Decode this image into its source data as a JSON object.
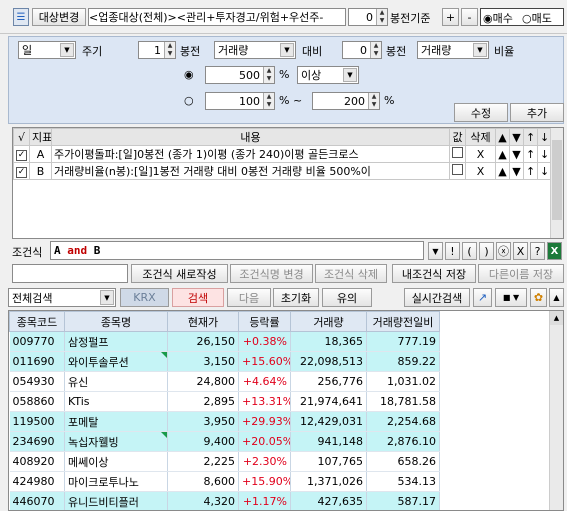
{
  "toolbar": {
    "change_target": "대상변경",
    "target_text": "<업종대상(전체)><관리+투자경고/위험+우선주-",
    "bongjeon_value": "0",
    "bongjeon_label": "봉전기준",
    "plus": "+",
    "minus": "-",
    "buy_label": "매수",
    "sell_label": "매도"
  },
  "form": {
    "period_value": "일",
    "period_label": "주기",
    "n1_value": "1",
    "bong1_label": "봉전",
    "field1_value": "거래량",
    "compare_label": "대비",
    "n2_value": "0",
    "bong2_label": "봉전",
    "field2_value": "거래량",
    "ratio_label": "비율",
    "val1": "500",
    "pct1": "%",
    "op_value": "이상",
    "val2": "100",
    "pct2": "% ~",
    "val3": "200",
    "pct3": "%",
    "modify_label": "수정",
    "add_label": "추가"
  },
  "conditions": {
    "headers": [
      "√",
      "지표",
      "내용",
      "값",
      "삭제",
      "▲",
      "▼",
      "↑",
      "↓"
    ],
    "rows": [
      {
        "id": "A",
        "content": "주가이평돌파:[일]0봉전 (종가 1)이평 (종가 240)이평 골든크로스",
        "del": "X",
        "up": "▲",
        "down": "▼",
        "top": "↑",
        "bottom": "↓"
      },
      {
        "id": "B",
        "content": "거래량비율(n봉):[일]1봉전 거래량 대비 0봉전 거래량 비율 500%이",
        "del": "X",
        "up": "▲",
        "down": "▼",
        "top": "↑",
        "bottom": "↓"
      }
    ]
  },
  "formula": {
    "label": "조건식",
    "a": "A",
    "and": "and",
    "b": "B",
    "btns": [
      "▼",
      "!",
      "(",
      ")",
      "ⓧ",
      "X",
      "?"
    ]
  },
  "actions": {
    "new": "조건식 새로작성",
    "rename": "조건식명 변경",
    "delete": "조건식 삭제",
    "save": "내조건식 저장",
    "save_as": "다른이름 저장"
  },
  "search": {
    "scope": "전체검색",
    "krx": "KRX",
    "search": "검색",
    "next": "다음",
    "reset": "초기화",
    "caution": "유의",
    "realtime": "실시간검색"
  },
  "colors": {
    "up": "#e0001b",
    "cyan": "#c5f4f6",
    "accent": "#1f5fbf"
  },
  "stocks": {
    "headers": [
      "종목코드",
      "종목명",
      "현재가",
      "등락률",
      "거래량",
      "거래량전일비"
    ],
    "rows": [
      {
        "code": "009770",
        "name": "삼정펄프",
        "price": "26,150",
        "rate": "+0.38%",
        "vol": "18,365",
        "ratio": "777.19"
      },
      {
        "code": "011690",
        "name": "와이투솔루션",
        "price": "3,150",
        "rate": "+15.60%",
        "vol": "22,098,513",
        "ratio": "859.22"
      },
      {
        "code": "054930",
        "name": "유신",
        "price": "24,800",
        "rate": "+4.64%",
        "vol": "256,776",
        "ratio": "1,031.02"
      },
      {
        "code": "058860",
        "name": "KTis",
        "price": "2,895",
        "rate": "+13.31%",
        "vol": "21,974,641",
        "ratio": "18,781.58"
      },
      {
        "code": "119500",
        "name": "포메탈",
        "price": "3,950",
        "rate": "+29.93%",
        "vol": "12,429,031",
        "ratio": "2,254.68"
      },
      {
        "code": "234690",
        "name": "녹십자웰빙",
        "price": "9,400",
        "rate": "+20.05%",
        "vol": "941,148",
        "ratio": "2,876.10"
      },
      {
        "code": "408920",
        "name": "메쎄이상",
        "price": "2,225",
        "rate": "+2.30%",
        "vol": "107,765",
        "ratio": "658.26"
      },
      {
        "code": "424980",
        "name": "마이크로투나노",
        "price": "8,600",
        "rate": "+15.90%",
        "vol": "1,371,026",
        "ratio": "534.13"
      },
      {
        "code": "446070",
        "name": "유니드비티플러",
        "price": "4,320",
        "rate": "+1.17%",
        "vol": "427,635",
        "ratio": "587.17"
      }
    ]
  }
}
